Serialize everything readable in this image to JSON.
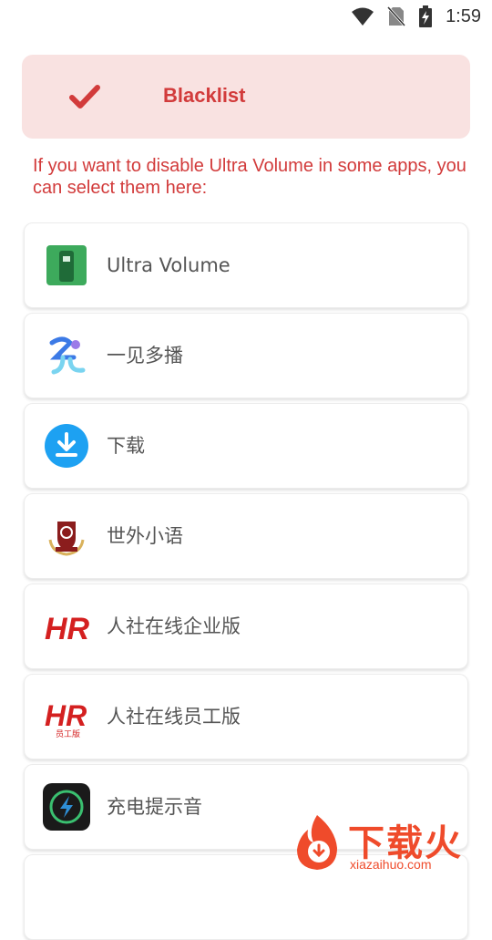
{
  "status_bar": {
    "time": "1:59"
  },
  "header": {
    "title": "Blacklist"
  },
  "description": "If you want to disable Ultra Volume in some apps, you can select them here:",
  "apps": [
    {
      "name": "Ultra Volume",
      "icon": "ultra-volume-icon"
    },
    {
      "name": "一见多播",
      "icon": "yijian-duobo-icon"
    },
    {
      "name": "下载",
      "icon": "download-icon"
    },
    {
      "name": "世外小语",
      "icon": "shiwai-xiaoyu-icon"
    },
    {
      "name": "人社在线企业版",
      "icon": "hr-enterprise-icon"
    },
    {
      "name": "人社在线员工版",
      "icon": "hr-employee-icon"
    },
    {
      "name": "充电提示音",
      "icon": "charging-sound-icon"
    }
  ],
  "hr_icon_text": "HR",
  "hr_icon_subtext": "员工版",
  "watermark": {
    "brand": "下载火",
    "url": "xiazaihuo.com"
  },
  "colors": {
    "accent": "#d23b3b",
    "header_bg": "#f9e2e1",
    "download_blue": "#1da1f2",
    "ultra_green": "#3daa5c"
  }
}
